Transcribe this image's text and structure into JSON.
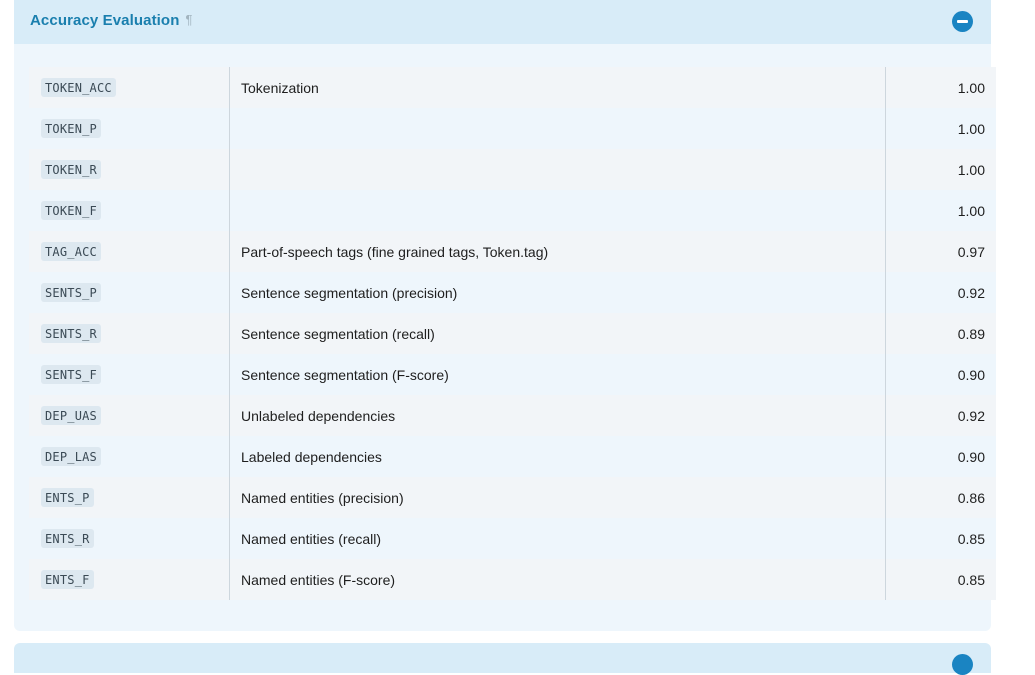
{
  "section": {
    "title": "Accuracy Evaluation",
    "anchor_glyph": "¶",
    "collapse_icon": "minus-circle-icon",
    "accent_color": "#1a84c2"
  },
  "table": {
    "rows": [
      {
        "key": "TOKEN_ACC",
        "description": "Tokenization",
        "value": "1.00"
      },
      {
        "key": "TOKEN_P",
        "description": "",
        "value": "1.00"
      },
      {
        "key": "TOKEN_R",
        "description": "",
        "value": "1.00"
      },
      {
        "key": "TOKEN_F",
        "description": "",
        "value": "1.00"
      },
      {
        "key": "TAG_ACC",
        "description": "Part-of-speech tags (fine grained tags, Token.tag)",
        "value": "0.97"
      },
      {
        "key": "SENTS_P",
        "description": "Sentence segmentation (precision)",
        "value": "0.92"
      },
      {
        "key": "SENTS_R",
        "description": "Sentence segmentation (recall)",
        "value": "0.89"
      },
      {
        "key": "SENTS_F",
        "description": "Sentence segmentation (F-score)",
        "value": "0.90"
      },
      {
        "key": "DEP_UAS",
        "description": "Unlabeled dependencies",
        "value": "0.92"
      },
      {
        "key": "DEP_LAS",
        "description": "Labeled dependencies",
        "value": "0.90"
      },
      {
        "key": "ENTS_P",
        "description": "Named entities (precision)",
        "value": "0.86"
      },
      {
        "key": "ENTS_R",
        "description": "Named entities (recall)",
        "value": "0.85"
      },
      {
        "key": "ENTS_F",
        "description": "Named entities (F-score)",
        "value": "0.85"
      }
    ]
  }
}
